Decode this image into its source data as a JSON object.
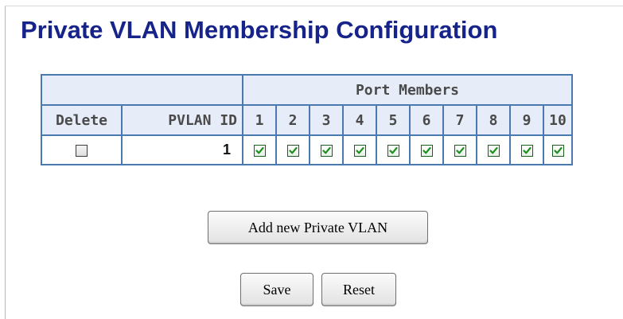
{
  "page": {
    "title": "Private VLAN Membership Configuration"
  },
  "table": {
    "group_header": "Port Members",
    "headers": {
      "delete": "Delete",
      "pvlan_id": "PVLAN ID",
      "ports": [
        "1",
        "2",
        "3",
        "4",
        "5",
        "6",
        "7",
        "8",
        "9",
        "10"
      ]
    },
    "rows": [
      {
        "delete_checked": false,
        "pvlan_id": "1",
        "ports_checked": [
          true,
          true,
          true,
          true,
          true,
          true,
          true,
          true,
          true,
          true
        ]
      }
    ]
  },
  "buttons": {
    "add_new": "Add new Private VLAN",
    "save": "Save",
    "reset": "Reset"
  },
  "colors": {
    "title": "#15238a",
    "table_border": "#4a79b0",
    "header_bg": "#e6edf9",
    "check_mark": "#1f8f1f"
  }
}
